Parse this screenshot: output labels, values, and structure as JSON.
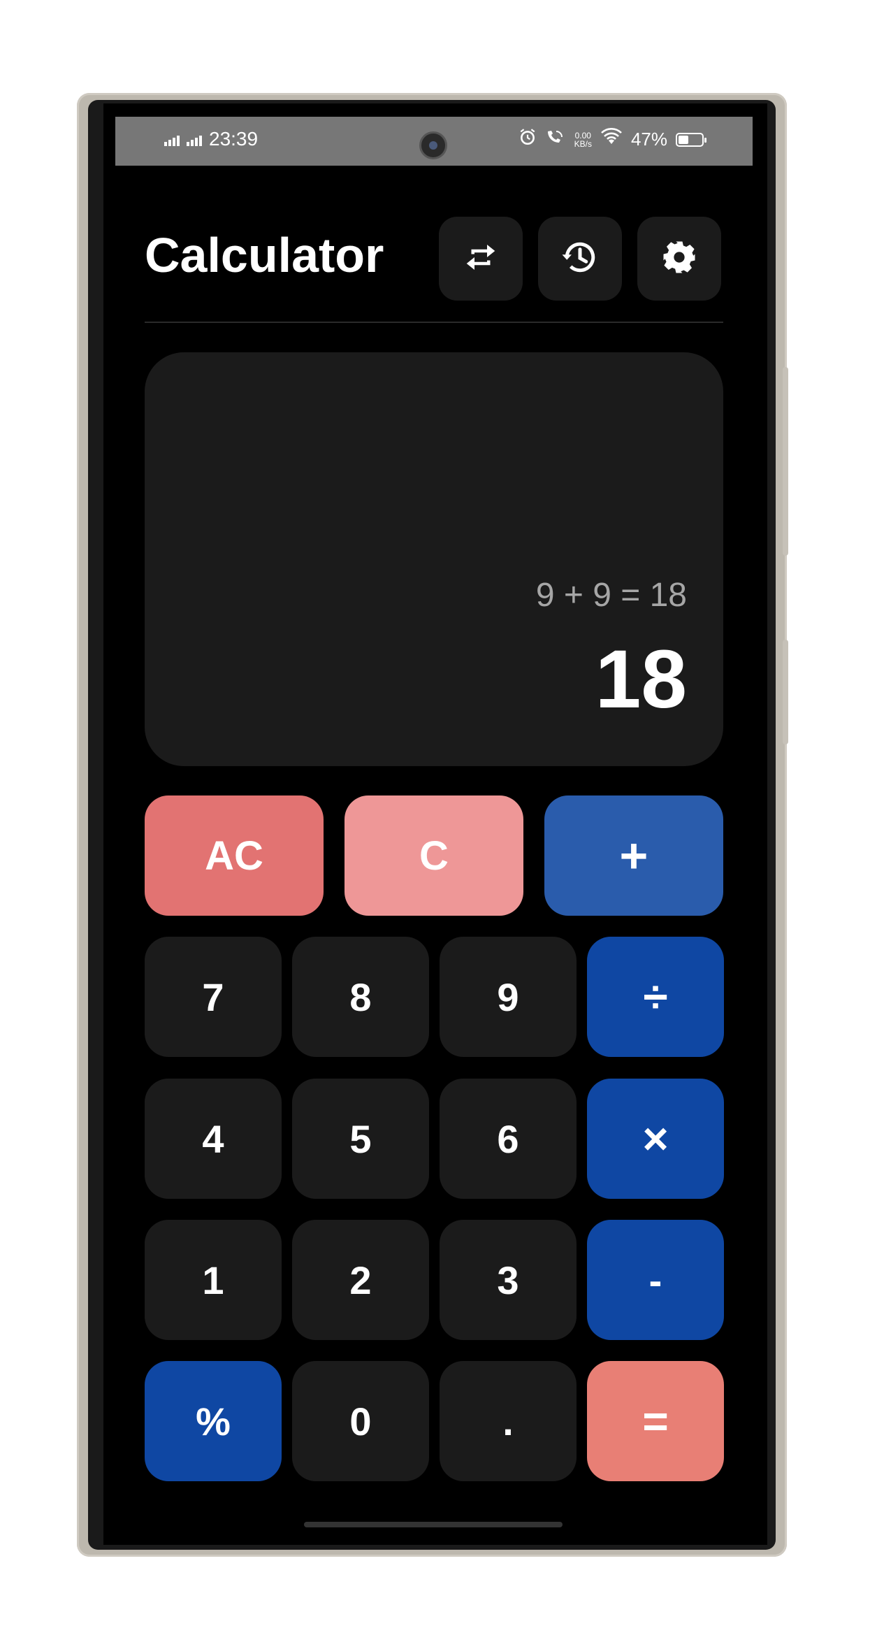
{
  "status_bar": {
    "time": "23:39",
    "net_speed": "0.00",
    "net_unit": "KB/s",
    "battery": "47%"
  },
  "header": {
    "title": "Calculator",
    "icons": [
      "swap-icon",
      "history-icon",
      "settings-icon"
    ]
  },
  "display": {
    "expression": "9 + 9 = 18",
    "result": "18"
  },
  "keys": {
    "ac": "AC",
    "c": "C",
    "plus": "+",
    "seven": "7",
    "eight": "8",
    "nine": "9",
    "divide": "÷",
    "four": "4",
    "five": "5",
    "six": "6",
    "multiply": "×",
    "one": "1",
    "two": "2",
    "three": "3",
    "minus": "-",
    "percent": "%",
    "zero": "0",
    "dot": ".",
    "equals": "="
  },
  "colors": {
    "background": "#000000",
    "surface": "#1b1b1b",
    "operator_blue": "#0f47a3",
    "plus_blue": "#2a5cac",
    "clear_red": "#e27372",
    "clear_pink": "#ee9797",
    "equals_coral": "#e87f75"
  }
}
